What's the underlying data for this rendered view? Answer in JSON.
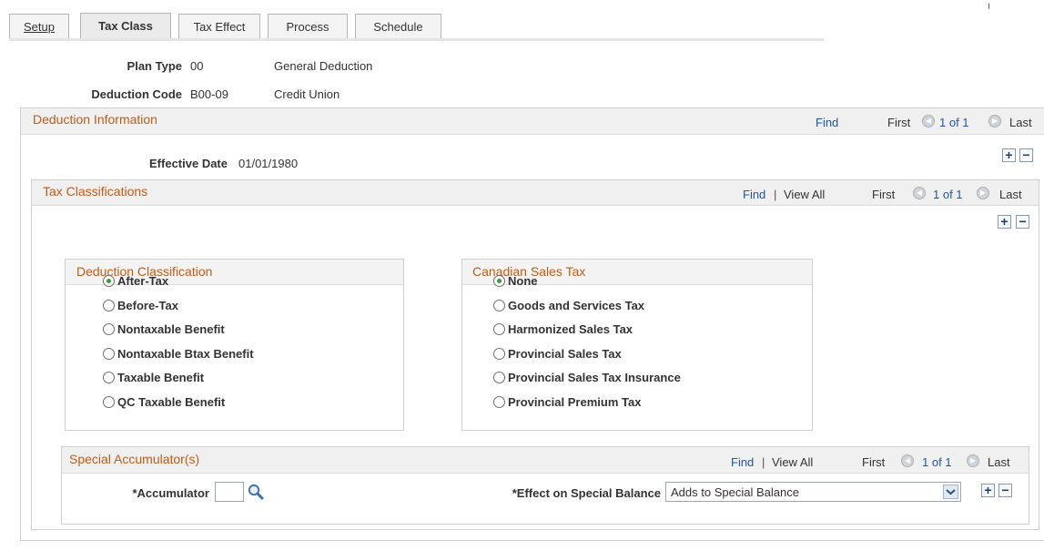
{
  "tabs": [
    {
      "label": "Setup"
    },
    {
      "label": "Tax Class"
    },
    {
      "label": "Tax Effect"
    },
    {
      "label": "Process"
    },
    {
      "label": "Schedule"
    }
  ],
  "header": {
    "plan_type_label": "Plan Type",
    "plan_type_code": "00",
    "plan_type_desc": "General Deduction",
    "deduction_code_label": "Deduction Code",
    "deduction_code_value": "B00-09",
    "deduction_code_desc": "Credit Union"
  },
  "deduction_info": {
    "title": "Deduction Information",
    "find": "Find",
    "first": "First",
    "count": "1 of 1",
    "last": "Last",
    "effective_date_label": "Effective Date",
    "effective_date_value": "01/01/1980"
  },
  "tax_classifications": {
    "title": "Tax Classifications",
    "find": "Find",
    "separator": "|",
    "view_all": "View All",
    "first": "First",
    "count": "1 of 1",
    "last": "Last"
  },
  "deduction_classification": {
    "title": "Deduction Classification",
    "options": [
      "After-Tax",
      "Before-Tax",
      "Nontaxable Benefit",
      "Nontaxable Btax Benefit",
      "Taxable Benefit",
      "QC Taxable Benefit"
    ],
    "selected": "After-Tax"
  },
  "canadian_sales_tax": {
    "title": "Canadian Sales Tax",
    "options": [
      "None",
      "Goods and Services Tax",
      "Harmonized Sales Tax",
      "Provincial Sales Tax",
      "Provincial Sales Tax Insurance",
      "Provincial Premium Tax"
    ],
    "selected": "None"
  },
  "special_accumulators": {
    "title": "Special Accumulator(s)",
    "find": "Find",
    "separator": "|",
    "view_all": "View All",
    "first": "First",
    "count": "1 of 1",
    "last": "Last",
    "accumulator_label": "*Accumulator",
    "accumulator_value": "",
    "effect_label": "*Effect on Special Balance",
    "effect_value": "Adds to Special Balance"
  },
  "icons": {
    "search": "search-icon",
    "add": "plus-icon",
    "remove": "minus-icon",
    "prev": "arrow-left-icon",
    "next": "arrow-right-icon",
    "dropdown": "chevron-down-icon"
  },
  "colors": {
    "section_title": "#c15c17",
    "link": "#1f56a2",
    "radio_selected": "#3a9b3a"
  }
}
